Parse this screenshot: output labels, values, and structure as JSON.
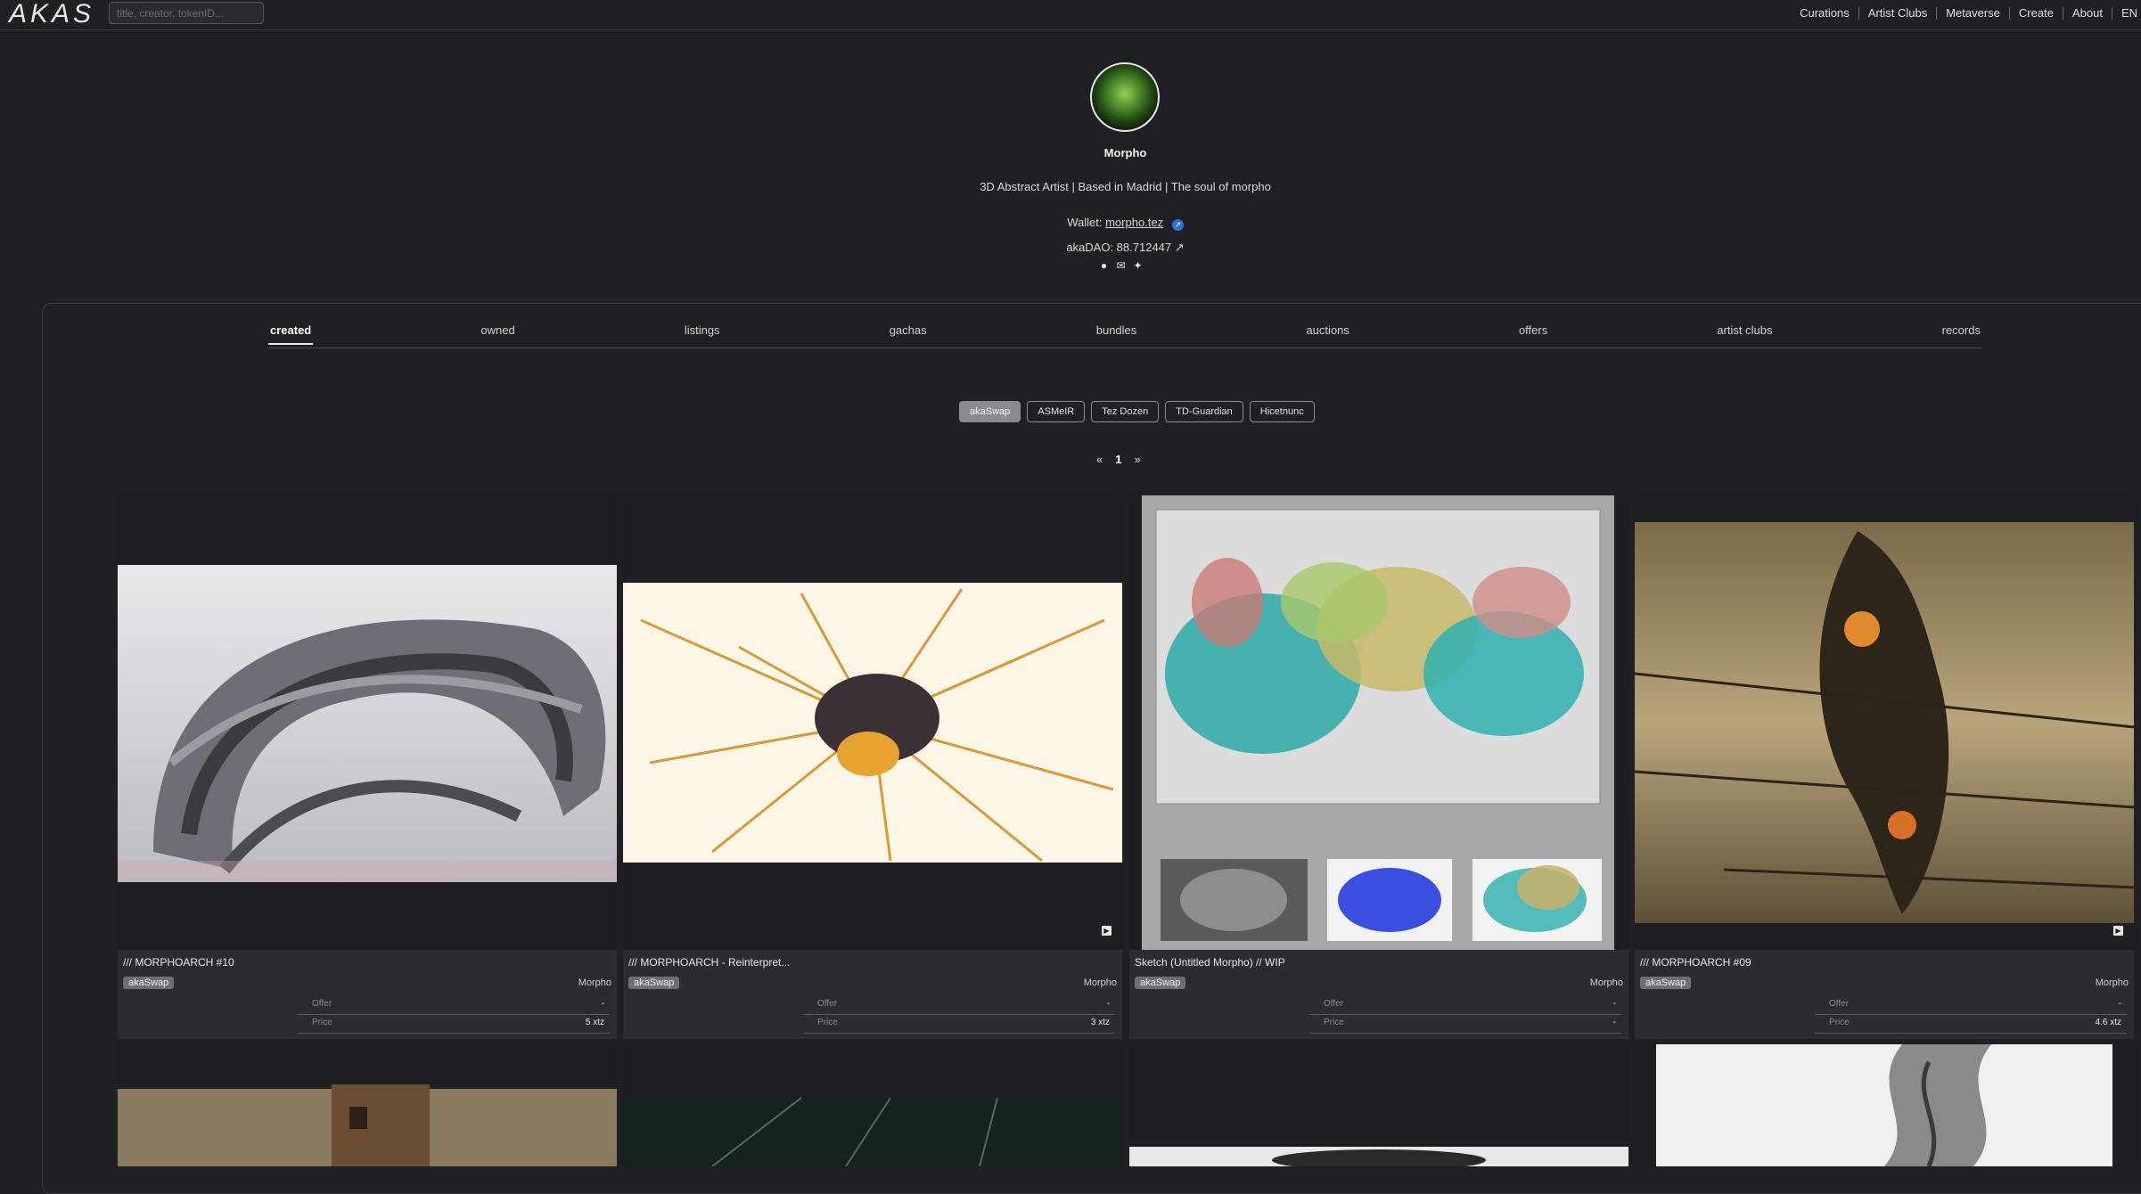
{
  "header": {
    "logo": "AKAS",
    "search_placeholder": "title, creator, tokenID...",
    "nav": [
      "Curations",
      "Artist Clubs",
      "Metaverse",
      "Create",
      "About"
    ],
    "lang": "EN"
  },
  "profile": {
    "name": "Morpho",
    "bio": "3D Abstract Artist | Based in Madrid | The soul of morpho",
    "wallet_label": "Wallet:",
    "wallet": "morpho.tez",
    "dao": "akaDAO: 88.712447"
  },
  "tabs": [
    "created",
    "owned",
    "listings",
    "gachas",
    "bundles",
    "auctions",
    "offers",
    "artist clubs",
    "records"
  ],
  "active_tab": "created",
  "filters": [
    "akaSwap",
    "ASMeIR",
    "Tez Dozen",
    "TD-Guardian",
    "Hicetnunc"
  ],
  "active_filter": "akaSwap",
  "pager": {
    "prev": "«",
    "current": "1",
    "next": "»"
  },
  "cards": [
    {
      "title": "/// MORPHOARCH #10",
      "platform": "akaSwap",
      "creator": "Morpho",
      "offer_label": "Offer",
      "offer": "-",
      "price_label": "Price",
      "price": "5 xtz"
    },
    {
      "title": "/// MORPHOARCH - Reinterpret...",
      "platform": "akaSwap",
      "creator": "Morpho",
      "offer_label": "Offer",
      "offer": "-",
      "price_label": "Price",
      "price": "3 xtz"
    },
    {
      "title": "Sketch (Untitled Morpho) // WIP",
      "platform": "akaSwap",
      "creator": "Morpho",
      "offer_label": "Offer",
      "offer": "-",
      "price_label": "Price",
      "price": "-"
    },
    {
      "title": "/// MORPHOARCH #09",
      "platform": "akaSwap",
      "creator": "Morpho",
      "offer_label": "Offer",
      "offer": "-",
      "price_label": "Price",
      "price": "4.6 xtz"
    }
  ],
  "icons": {
    "wallet_link": "external-link-icon",
    "social": [
      "globe-icon",
      "mail-icon",
      "twitter-icon"
    ],
    "video": "play-icon"
  },
  "colors": {
    "background": "#1f2024",
    "card": "#2b2c31",
    "badge": "#6e6f74"
  }
}
